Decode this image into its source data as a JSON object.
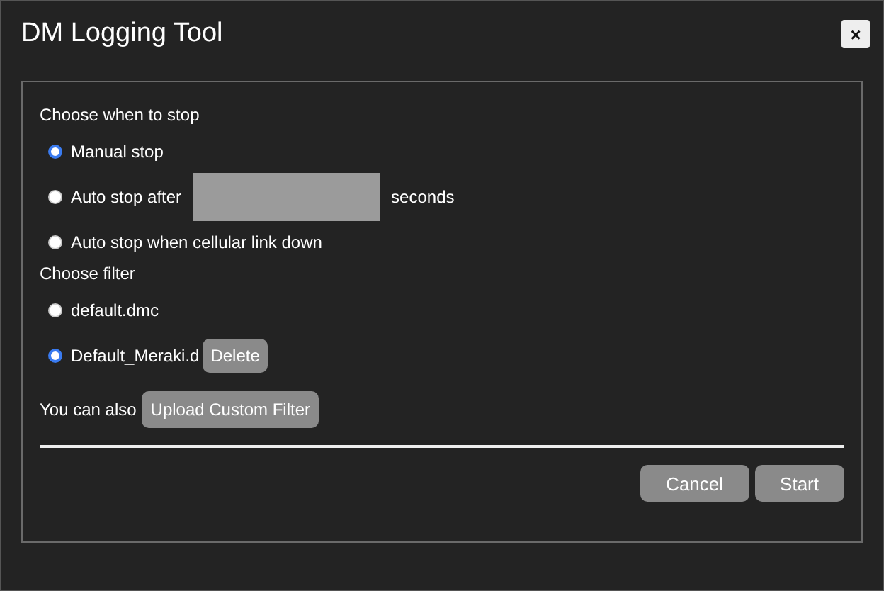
{
  "dialog": {
    "title": "DM Logging Tool",
    "close": "×"
  },
  "stop_section": {
    "heading": "Choose when to stop",
    "options": [
      {
        "kind": "plain",
        "label": "Manual stop",
        "selected": true
      },
      {
        "kind": "duration",
        "label": "Auto stop after",
        "unit": "seconds",
        "selected": false
      },
      {
        "kind": "plain",
        "label": "Auto stop when cellular link down",
        "selected": false
      }
    ]
  },
  "filter_section": {
    "heading": "Choose filter",
    "options": [
      {
        "label": "default.dmc",
        "selected": false
      },
      {
        "label": "Default_Meraki.d",
        "delete": "Delete",
        "selected": true
      }
    ]
  },
  "upload": {
    "text": "You can also",
    "button": "Upload Custom Filter"
  },
  "buttons": [
    "Cancel",
    "Start"
  ]
}
